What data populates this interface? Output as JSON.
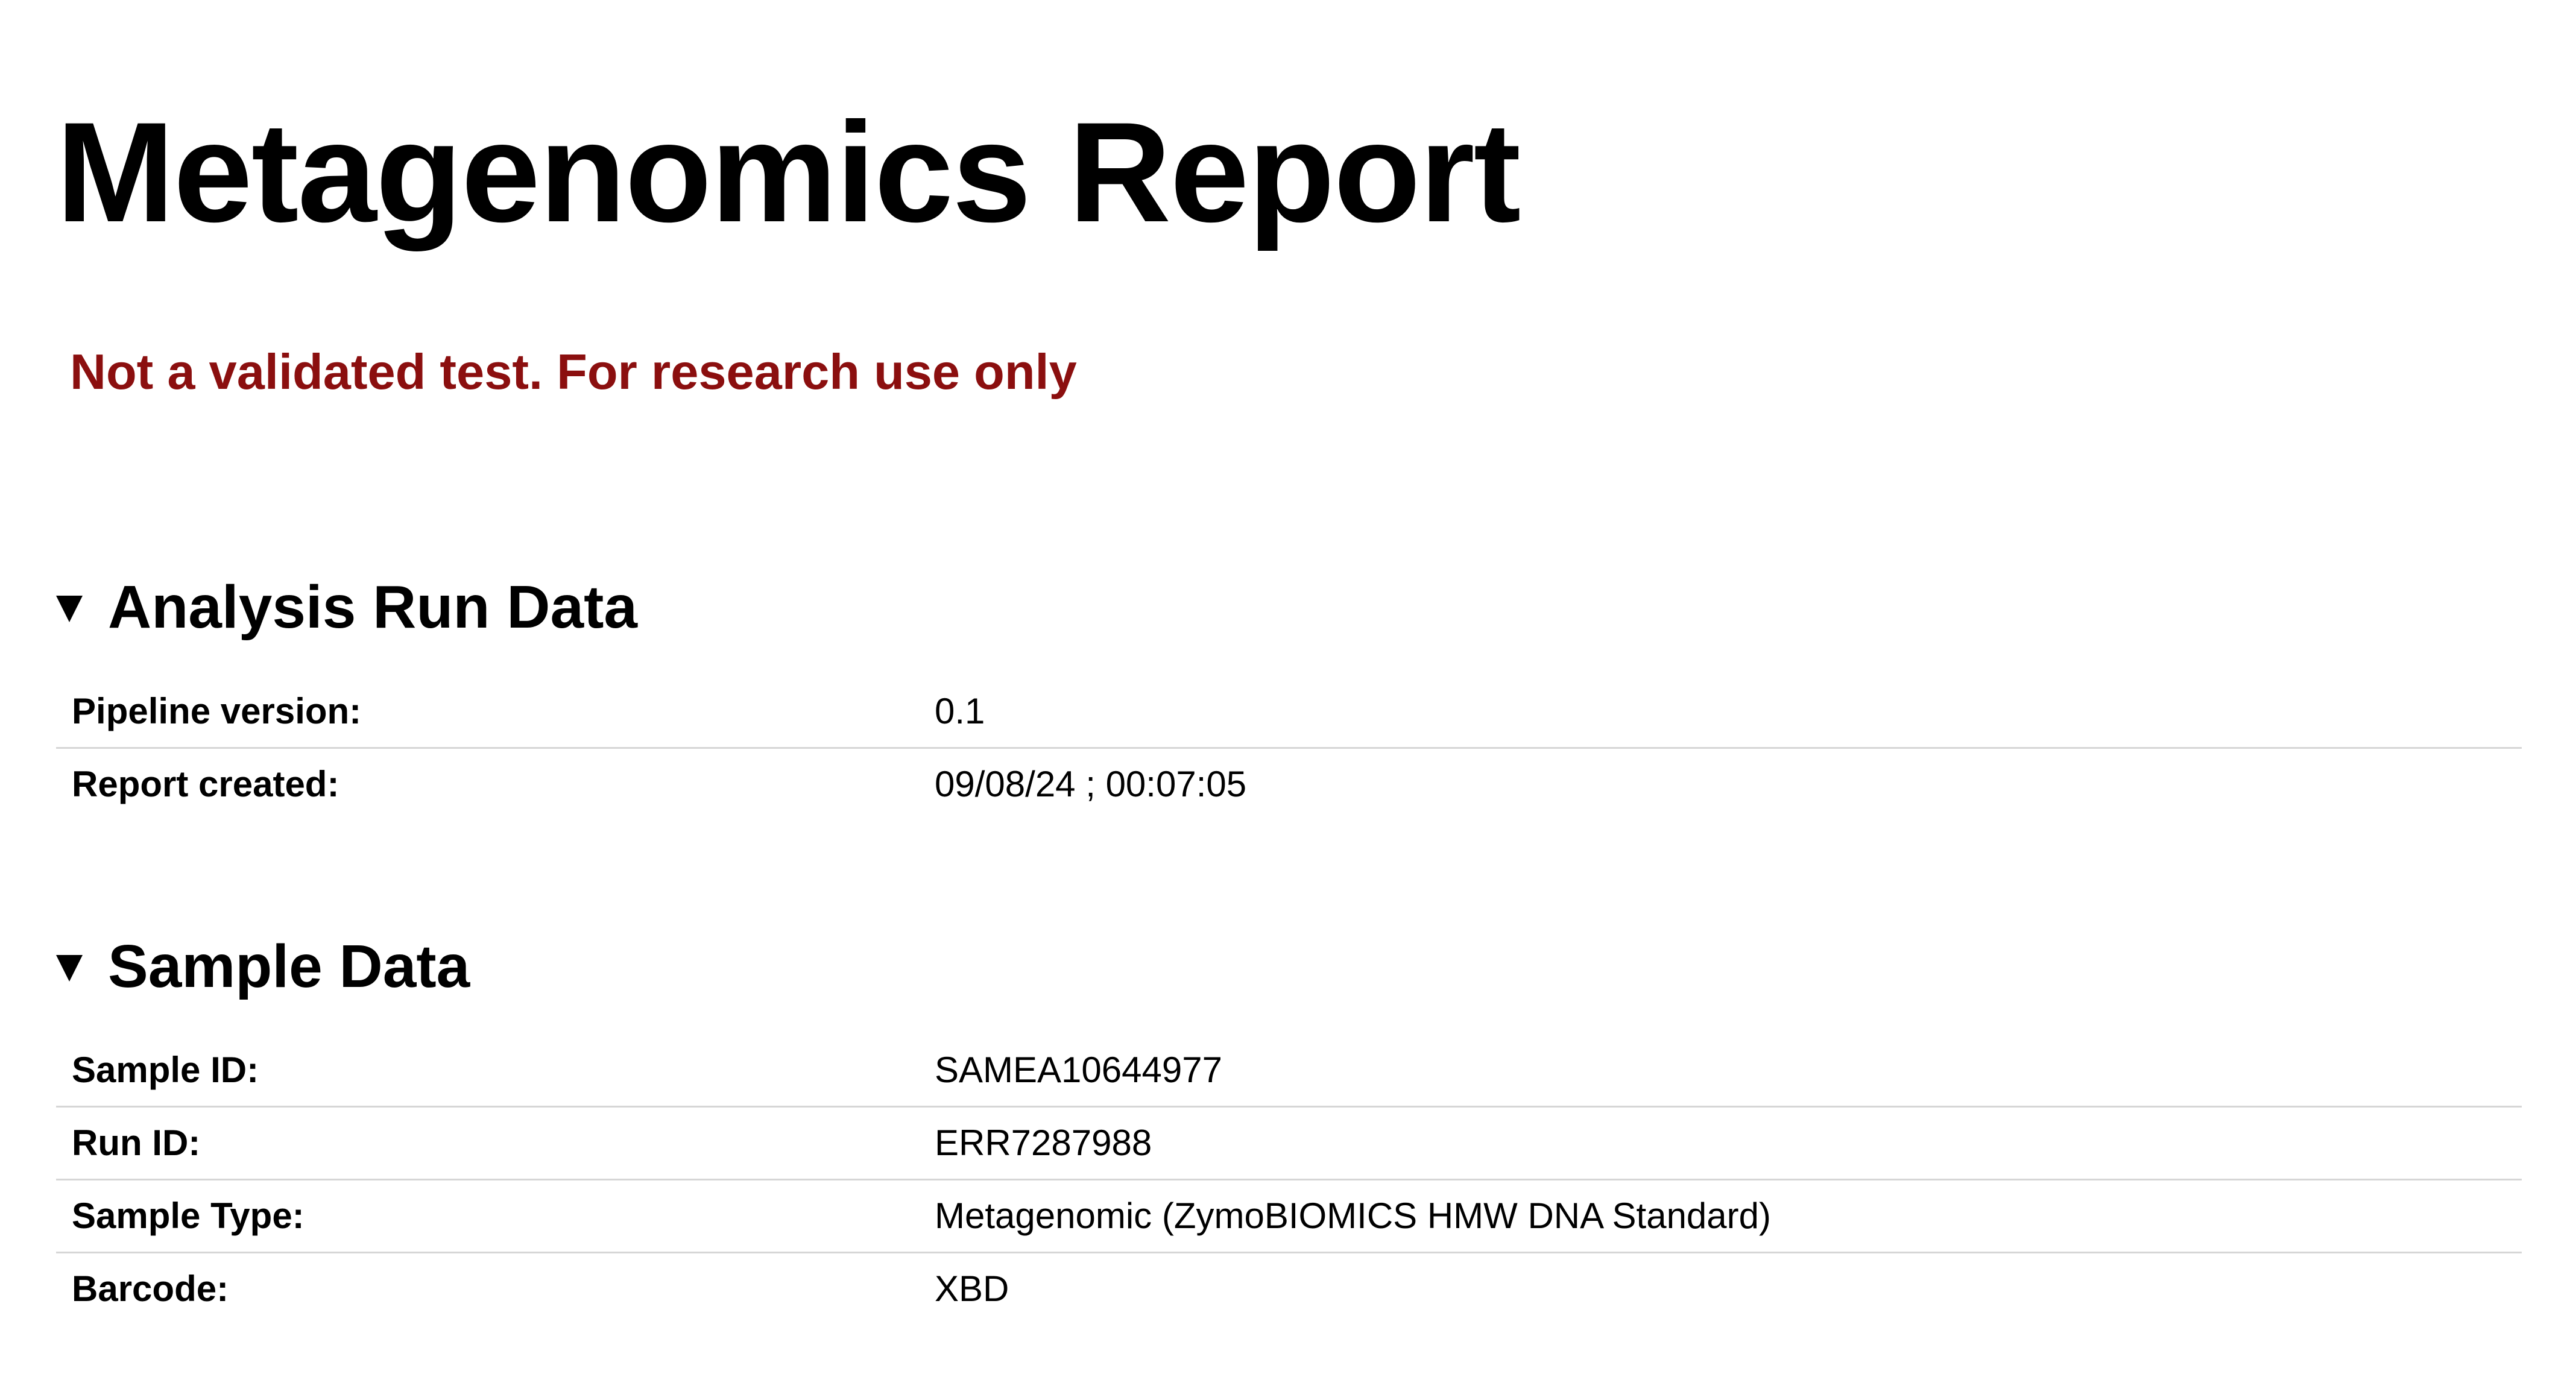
{
  "report": {
    "title": "Metagenomics Report",
    "disclaimer": "Not a validated test. For research use only",
    "colors": {
      "disclaimer": "#8b0f0f",
      "divider": "#d6d6d6"
    }
  },
  "sections": {
    "analysis_run": {
      "toggle_icon": "triangle-down-icon",
      "title": "Analysis Run Data",
      "rows": [
        {
          "label": "Pipeline version:",
          "value": "0.1"
        },
        {
          "label": "Report created:",
          "value": "09/08/24 ; 00:07:05"
        }
      ]
    },
    "sample": {
      "toggle_icon": "triangle-down-icon",
      "title": "Sample Data",
      "rows": [
        {
          "label": "Sample ID:",
          "value": "SAMEA10644977"
        },
        {
          "label": "Run ID:",
          "value": "ERR7287988"
        },
        {
          "label": "Sample Type:",
          "value": "Metagenomic (ZymoBIOMICS HMW DNA Standard)"
        },
        {
          "label": "Barcode:",
          "value": "XBD"
        }
      ]
    }
  }
}
